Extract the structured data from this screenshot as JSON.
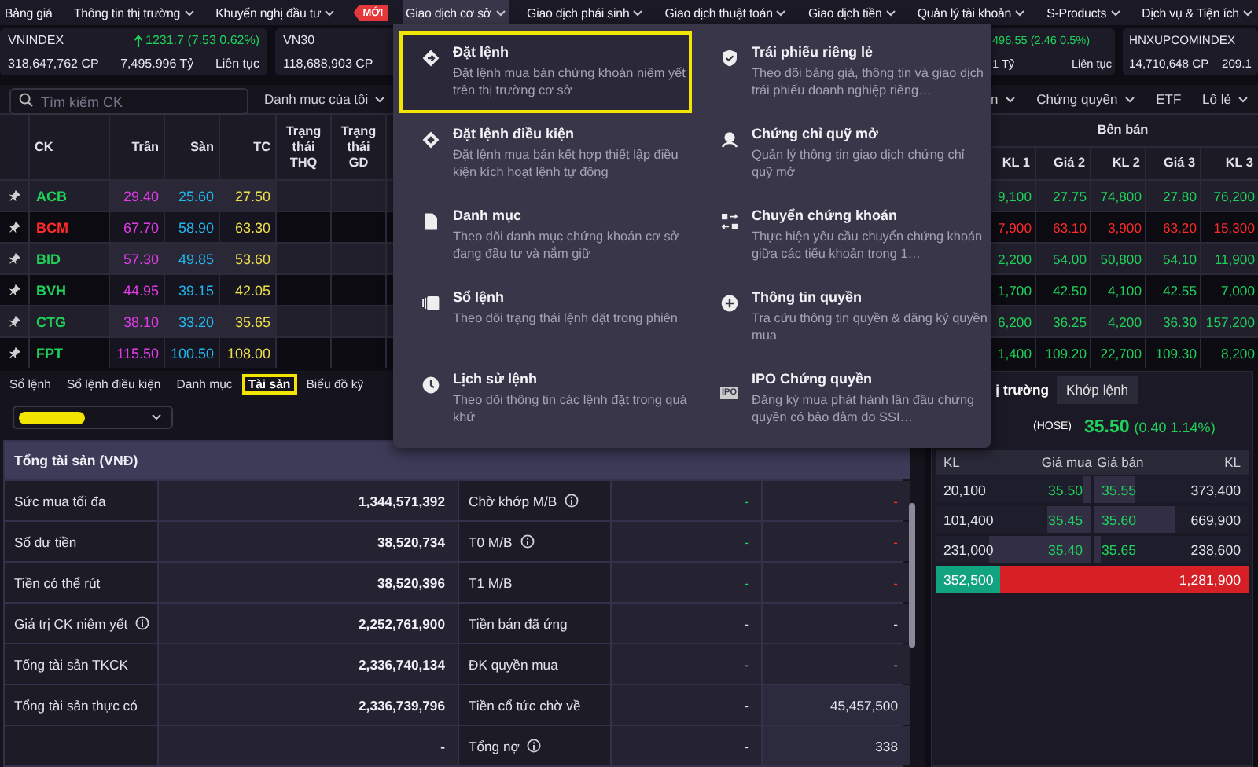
{
  "nav": {
    "items": [
      {
        "label": "Bảng giá",
        "dropdown": false,
        "selected": false
      },
      {
        "label": "Thông tin thị trường",
        "dropdown": true,
        "selected": false
      },
      {
        "label": "Khuyến nghị đầu tư",
        "dropdown": true,
        "selected": false,
        "badge": "MỚI"
      },
      {
        "label": "Giao dịch cơ sở",
        "dropdown": true,
        "selected": true
      },
      {
        "label": "Giao dịch phái sinh",
        "dropdown": true,
        "selected": false
      },
      {
        "label": "Giao dịch thuật toán",
        "dropdown": true,
        "selected": false
      },
      {
        "label": "Giao dịch tiền",
        "dropdown": true,
        "selected": false
      },
      {
        "label": "Quản lý tài khoản",
        "dropdown": true,
        "selected": false
      },
      {
        "label": "S-Products",
        "dropdown": true,
        "selected": false
      },
      {
        "label": "Dịch vụ & Tiện ích",
        "dropdown": true,
        "selected": false
      }
    ]
  },
  "indices": [
    {
      "name": "VNINDEX",
      "change": "1231.7 (7.53 0.62%)",
      "color": "#1fd15a",
      "volume": "318,647,762 CP",
      "value": "7,495.996 Tỷ",
      "session": "Liên tục"
    },
    {
      "name": "VN30",
      "volume": "118,688,903 CP"
    },
    {
      "change": "496.55 (2.46 0.5%)",
      "color": "#1fd15a",
      "value": "1 Tỷ",
      "session": "Liên tục"
    },
    {
      "name": "HNXUPCOMINDEX",
      "volume": "14,710,648 CP",
      "value": "209.1"
    }
  ],
  "watchlist": {
    "search": {
      "placeholder": "Tìm kiếm CK"
    },
    "list_select": "Danh mục của tôi",
    "filters": [
      {
        "label": "n",
        "dropdown": true
      },
      {
        "label": "Chứng quyền",
        "dropdown": true
      },
      {
        "label": "ETF",
        "dropdown": false
      },
      {
        "label": "Lô lẻ",
        "dropdown": true
      }
    ],
    "columns": [
      "CK",
      "Trần",
      "Sàn",
      "TC",
      "Trạng thái THQ",
      "Trạng thái GD"
    ],
    "sell_group": "Bên bán",
    "sell_columns": [
      "KL 1",
      "Giá 2",
      "KL 2",
      "Giá 3",
      "KL 3"
    ],
    "rows": [
      {
        "symbol": "ACB",
        "ceiling": "29.40",
        "floor": "25.60",
        "ref": "27.50",
        "color": "#1fd15a",
        "sell": [
          "9,100",
          "27.75",
          "74,800",
          "27.80",
          "76,200"
        ]
      },
      {
        "symbol": "BCM",
        "ceiling": "67.70",
        "floor": "58.90",
        "ref": "63.30",
        "color": "#ff2a2a",
        "sell": [
          "7,900",
          "63.10",
          "3,900",
          "63.20",
          "15,300"
        ]
      },
      {
        "symbol": "BID",
        "ceiling": "57.30",
        "floor": "49.85",
        "ref": "53.60",
        "color": "#1fd15a",
        "sell": [
          "2,200",
          "54.00",
          "50,800",
          "54.10",
          "11,900"
        ]
      },
      {
        "symbol": "BVH",
        "ceiling": "44.95",
        "floor": "39.15",
        "ref": "42.05",
        "color": "#1fd15a",
        "sell": [
          "1,700",
          "42.50",
          "4,100",
          "42.55",
          "7,000"
        ]
      },
      {
        "symbol": "CTG",
        "ceiling": "38.10",
        "floor": "33.20",
        "ref": "35.65",
        "color": "#1fd15a",
        "sell": [
          "6,200",
          "36.25",
          "4,200",
          "36.30",
          "157,200"
        ]
      },
      {
        "symbol": "FPT",
        "ceiling": "115.50",
        "floor": "100.50",
        "ref": "108.00",
        "color": "#1fd15a",
        "sell": [
          "1,400",
          "109.20",
          "22,700",
          "109.30",
          "8,200"
        ]
      }
    ]
  },
  "menu": {
    "items": [
      {
        "title": "Đặt lệnh",
        "description": "Đặt lệnh mua bán chứng khoán niêm yết trên thị trường cơ sở",
        "selected": true
      },
      {
        "title": "Trái phiếu riêng lẻ",
        "description": "Theo dõi bảng giá, thông tin và giao dịch trái phiếu doanh nghiệp riêng…",
        "selected": false
      },
      {
        "title": "Đặt lệnh điều kiện",
        "description": "Đặt lệnh mua bán kết hợp thiết lập điều kiện kích hoạt lệnh tự động",
        "selected": false
      },
      {
        "title": "Chứng chỉ quỹ mở",
        "description": "Quản lý thông tin giao dịch chứng chỉ quỹ mở",
        "selected": false
      },
      {
        "title": "Danh mục",
        "description": "Theo dõi danh mục chứng khoán cơ sở đang đầu tư và nắm giữ",
        "selected": false
      },
      {
        "title": "Chuyển chứng khoán",
        "description": "Thực hiện yêu cầu chuyển chứng khoán giữa các tiểu khoản trong 1…",
        "selected": false
      },
      {
        "title": "Sổ lệnh",
        "description": "Theo dõi trạng thái lệnh đặt trong phiên",
        "selected": false
      },
      {
        "title": "Thông tin quyền",
        "description": "Tra cứu thông tin quyền & đăng ký quyền mua",
        "selected": false
      },
      {
        "title": "Lịch sử lệnh",
        "description": "Theo dõi thông tin các lệnh đặt trong quá khứ",
        "selected": false
      },
      {
        "title": "IPO Chứng quyền",
        "description": "Đăng ký mua phát hành lần đầu chứng quyền có bảo đảm do SSI…",
        "selected": false,
        "icon_text": "IPO"
      }
    ]
  },
  "orders_panel": {
    "tabs": [
      {
        "label": "Sổ lệnh",
        "selected": false
      },
      {
        "label": "Sổ lệnh điều kiện",
        "selected": false
      },
      {
        "label": "Danh mục",
        "selected": false
      },
      {
        "label": "Tài sản",
        "selected": true
      },
      {
        "label": "Biểu đồ kỹ",
        "selected": false
      }
    ],
    "account_select": {
      "redacted": true
    }
  },
  "assets": {
    "title": "Tổng tài sản (VNĐ)",
    "rows": [
      {
        "label": "Sức mua tối đa",
        "info": false,
        "value": "1,344,571,392",
        "label2": "Chờ khớp M/B",
        "info2": true,
        "col3": "-",
        "col4": "-",
        "colored": true
      },
      {
        "label": "Số dư tiền",
        "info": false,
        "value": "38,520,734",
        "label2": "T0 M/B",
        "info2": true,
        "col3": "-",
        "col4": "-",
        "colored": true
      },
      {
        "label": "Tiền có thể rút",
        "info": false,
        "value": "38,520,396",
        "label2": "T1 M/B",
        "info2": false,
        "col3": "-",
        "col4": "-",
        "colored": true
      },
      {
        "label": "Giá trị CK niêm yết",
        "info": true,
        "value": "2,252,761,900",
        "label2": "Tiền bán đã ứng",
        "info2": false,
        "col3": "-",
        "col4": "-",
        "colored": false
      },
      {
        "label": "Tổng tài sản TKCK",
        "info": false,
        "value": "2,336,740,134",
        "label2": "ĐK quyền mua",
        "info2": false,
        "col3": "-",
        "col4": "-",
        "colored": false
      },
      {
        "label": "Tổng tài sản thực có",
        "info": false,
        "value": "2,336,739,796",
        "label2": "Tiền cổ tức chờ về",
        "info2": false,
        "col3": "-",
        "col4": "45,457,500",
        "colored": false
      },
      {
        "info": false,
        "value": "-",
        "label2": "Tổng nợ",
        "info2": true,
        "col3": "-",
        "col4": "338",
        "colored": false
      }
    ]
  },
  "order_book": {
    "tabs": [
      {
        "label": "ị trường",
        "selected": true
      },
      {
        "label": "Khớp lệnh",
        "selected": false
      }
    ],
    "exchange": "(HOSE)",
    "price": "35.50",
    "change": "(0.40 1.14%)",
    "columns": [
      "KL",
      "Giá mua",
      "Giá bán",
      "KL"
    ],
    "rows": [
      {
        "bid_volume": "20,100",
        "bid": "35.50",
        "ask": "35.55",
        "ask_volume": "373,400",
        "bid_depth": {
          "level": 0.05
        },
        "ask_depth": {
          "level": 0.27
        }
      },
      {
        "bid_volume": "101,400",
        "bid": "35.45",
        "ask": "35.60",
        "ask_volume": "669,900",
        "bid_depth": {
          "level": 0.28
        },
        "ask_depth": {
          "level": 0.52
        }
      },
      {
        "bid_volume": "231,000",
        "bid": "35.40",
        "ask": "35.65",
        "ask_volume": "238,600",
        "bid_depth": {
          "level": 0.65
        },
        "ask_depth": {
          "level": 0.05
        }
      }
    ],
    "totals": {
      "buy": "352,500",
      "sell": "1,281,900",
      "level": 0.21
    }
  }
}
